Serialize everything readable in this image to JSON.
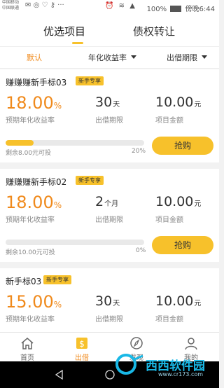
{
  "status_bar": {
    "carrier_line1": "中国移动",
    "carrier_line2": "中国联通",
    "battery": "100%",
    "time": "傍晚6:44"
  },
  "tabs": [
    {
      "label": "优选项目",
      "active": true
    },
    {
      "label": "债权转让",
      "active": false
    }
  ],
  "filters": [
    {
      "label": "默认",
      "active": true
    },
    {
      "label": "年化收益率",
      "active": false
    },
    {
      "label": "出借期限",
      "active": false
    }
  ],
  "labels": {
    "rate_caption": "预期年化收益率",
    "term_caption": "出借期限",
    "amount_caption": "项目金额",
    "buy_button": "抢购"
  },
  "products": [
    {
      "name": "赚赚赚新手标03",
      "badge": "新手专享",
      "rate": "18.00",
      "rate_unit": "%",
      "term": "30",
      "term_unit": "天",
      "amount": "10.00",
      "amount_unit": "元",
      "remaining": "剩余8.00元可投",
      "progress_percent": "20%",
      "progress": 0.2
    },
    {
      "name": "赚赚赚新手标02",
      "badge": "新手专享",
      "rate": "18.00",
      "rate_unit": "%",
      "term": "2",
      "term_unit": "个月",
      "amount": "10.00",
      "amount_unit": "元",
      "remaining": "剩余10.00元可投",
      "progress_percent": "0%",
      "progress": 0
    },
    {
      "name": "新手标03",
      "badge": "新手专享",
      "rate": "15.00",
      "rate_unit": "%",
      "term": "30",
      "term_unit": "天",
      "amount": "10.00",
      "amount_unit": "元"
    }
  ],
  "bottom_nav": [
    {
      "label": "首页",
      "icon": "home-icon",
      "active": false
    },
    {
      "label": "出借",
      "icon": "money-icon",
      "active": true
    },
    {
      "label": "发现",
      "icon": "compass-icon",
      "active": false
    },
    {
      "label": "我的",
      "icon": "user-icon",
      "active": false
    }
  ],
  "watermark": {
    "text": "西西软件园",
    "url": "www.cr173.com"
  },
  "colors": {
    "accent": "#f7c12b",
    "rate_orange": "#f08a1c"
  }
}
